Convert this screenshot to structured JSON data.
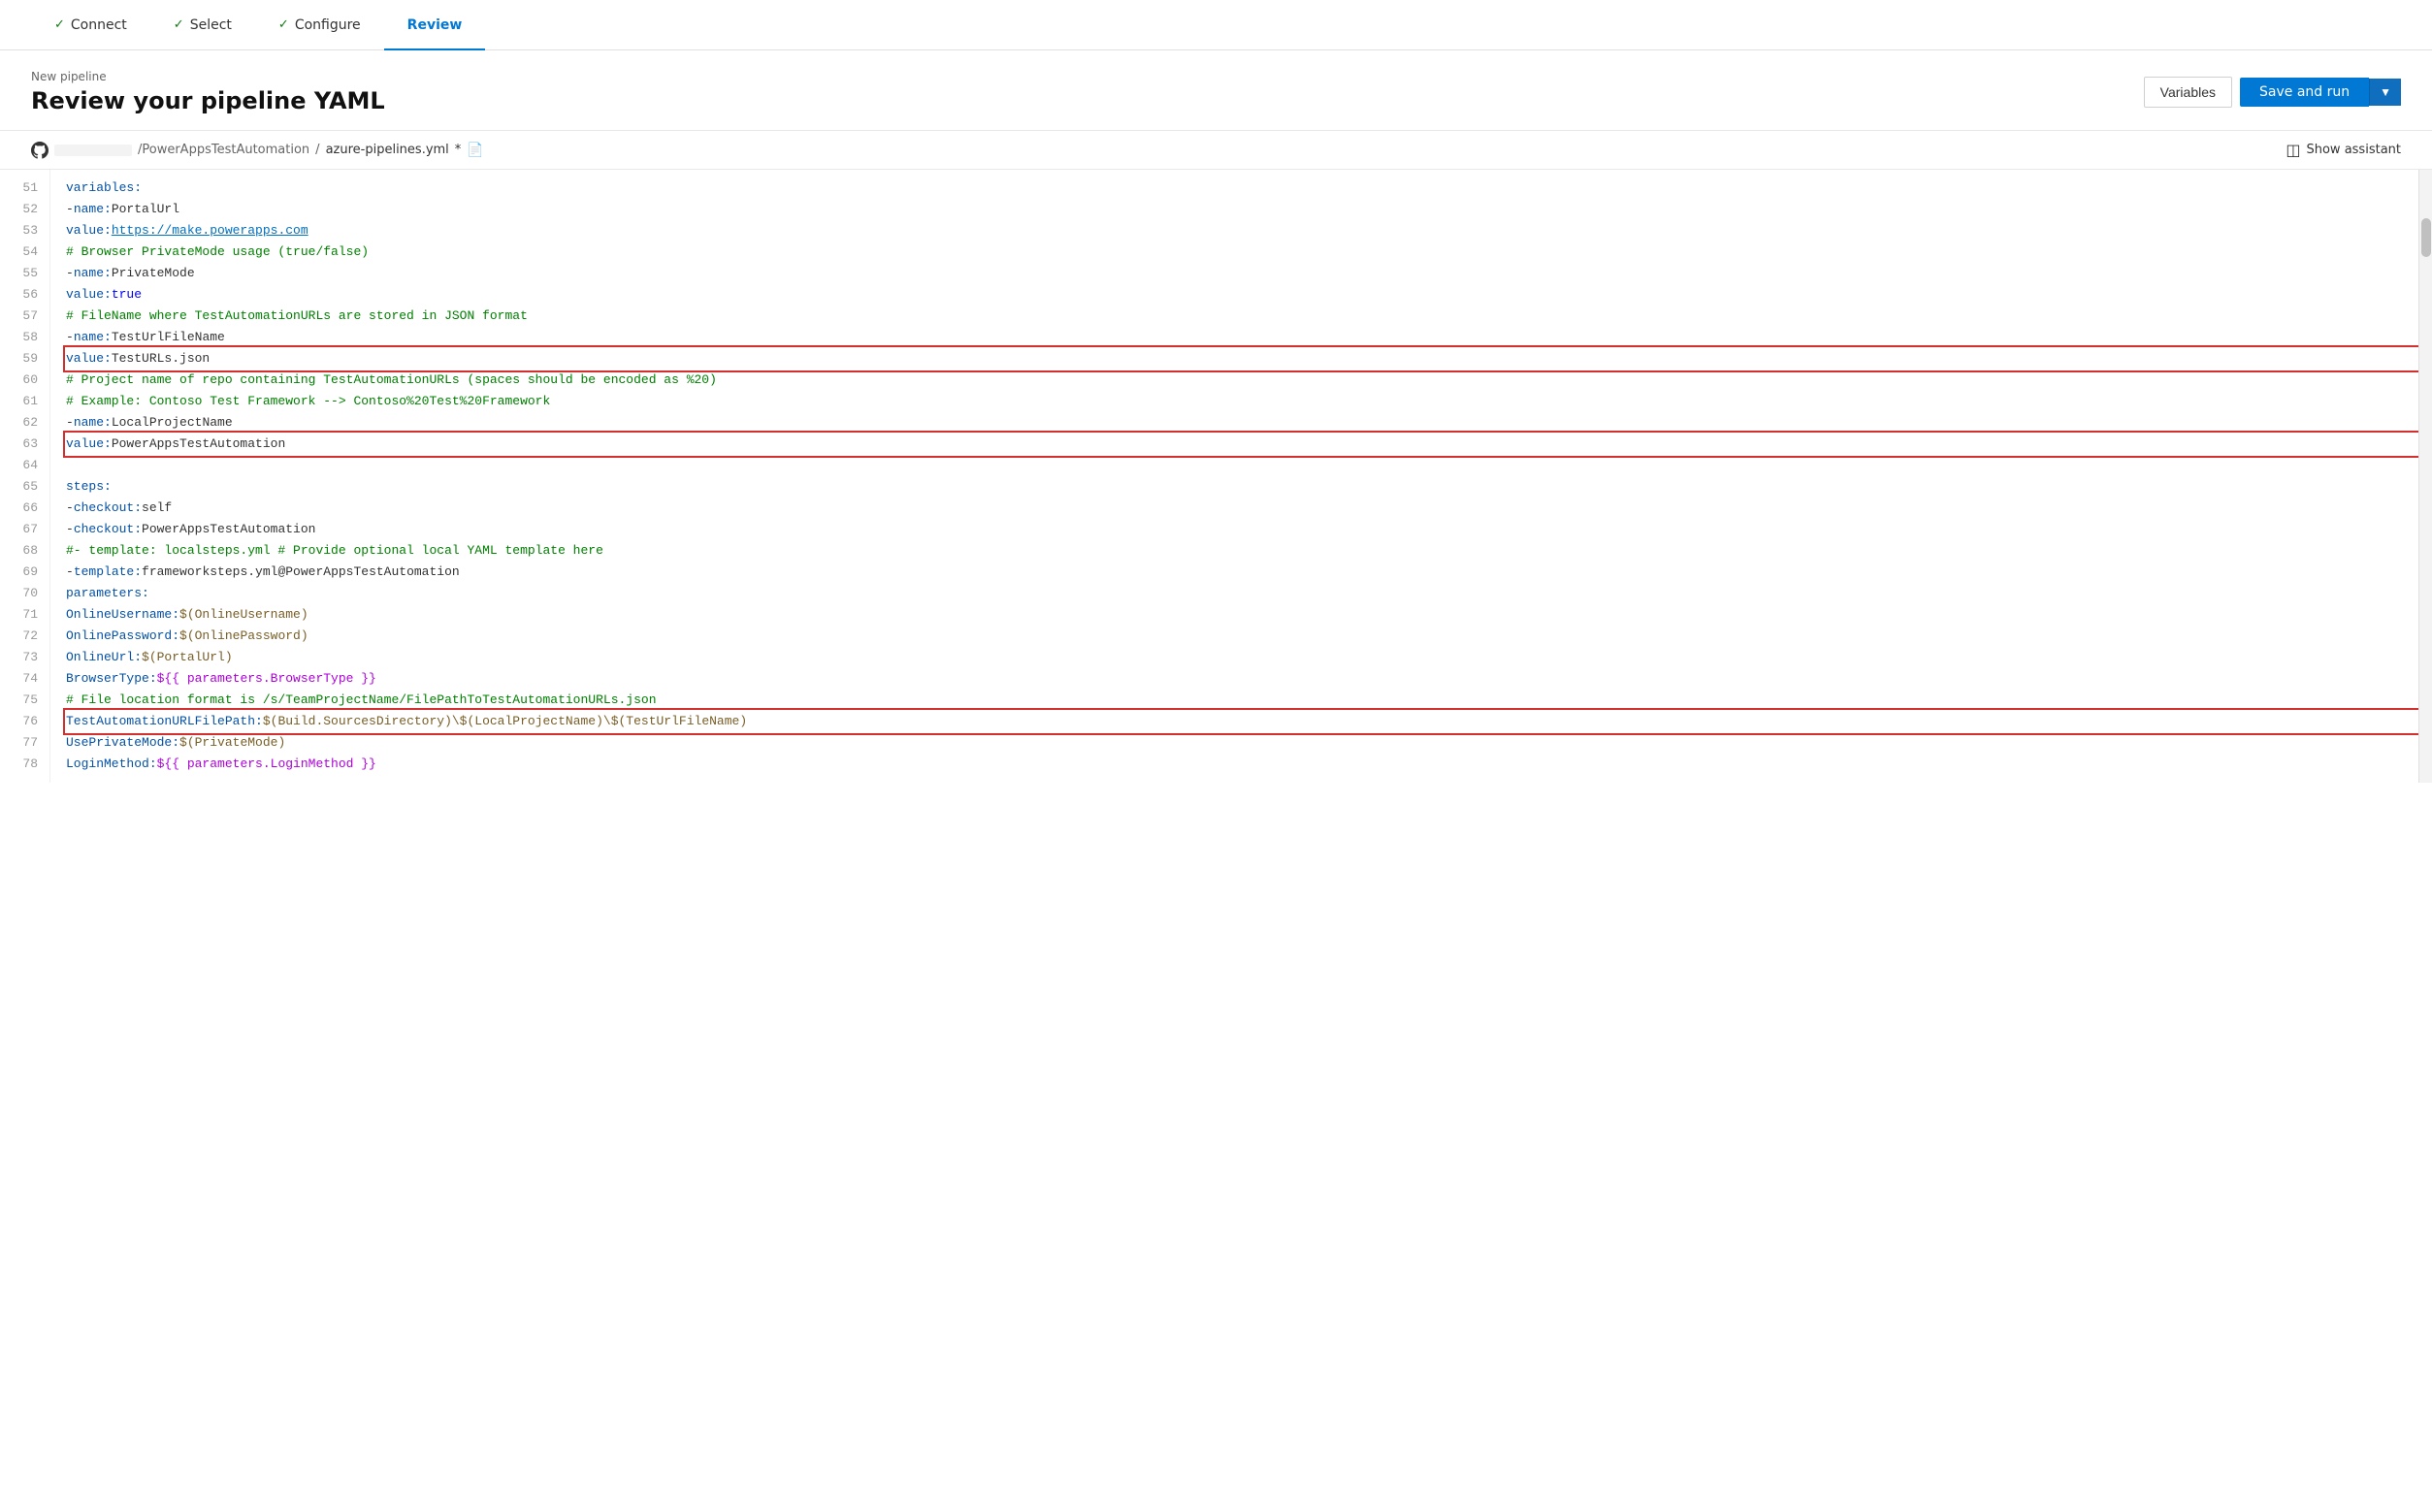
{
  "wizard": {
    "steps": [
      {
        "id": "connect",
        "label": "Connect",
        "completed": true,
        "active": false
      },
      {
        "id": "select",
        "label": "Select",
        "completed": true,
        "active": false
      },
      {
        "id": "configure",
        "label": "Configure",
        "completed": true,
        "active": false
      },
      {
        "id": "review",
        "label": "Review",
        "completed": false,
        "active": true
      }
    ]
  },
  "header": {
    "breadcrumb": "New pipeline",
    "title": "Review your pipeline YAML",
    "variables_btn": "Variables",
    "save_run_btn": "Save and run"
  },
  "file_bar": {
    "repo_placeholder": "repo",
    "repo_name": "/PowerAppsTestAutomation",
    "sep1": "/",
    "file_name": "azure-pipelines.yml",
    "modified": "*",
    "show_assistant": "Show assistant"
  },
  "code": {
    "lines": [
      {
        "num": 51,
        "content": "variables:",
        "parts": [
          {
            "t": "key",
            "v": "variables:"
          }
        ]
      },
      {
        "num": 52,
        "content": "  - name: PortalUrl",
        "parts": [
          {
            "t": "dash",
            "v": "  - "
          },
          {
            "t": "key",
            "v": "name:"
          },
          {
            "t": "text",
            "v": " PortalUrl"
          }
        ]
      },
      {
        "num": 53,
        "content": "    value: https://make.powerapps.com",
        "parts": [
          {
            "t": "indent",
            "v": "    "
          },
          {
            "t": "key",
            "v": "value:"
          },
          {
            "t": "text",
            "v": " "
          },
          {
            "t": "url",
            "v": "https://make.powerapps.com"
          }
        ]
      },
      {
        "num": 54,
        "content": "    # Browser PrivateMode usage (true/false)",
        "parts": [
          {
            "t": "indent",
            "v": "    "
          },
          {
            "t": "comment",
            "v": "# Browser PrivateMode usage (true/false)"
          }
        ]
      },
      {
        "num": 55,
        "content": "  - name: PrivateMode",
        "parts": [
          {
            "t": "dash",
            "v": "  - "
          },
          {
            "t": "key",
            "v": "name:"
          },
          {
            "t": "text",
            "v": " PrivateMode"
          }
        ]
      },
      {
        "num": 56,
        "content": "    value: true",
        "parts": [
          {
            "t": "indent",
            "v": "    "
          },
          {
            "t": "key",
            "v": "value:"
          },
          {
            "t": "text",
            "v": " "
          },
          {
            "t": "bool",
            "v": "true"
          }
        ]
      },
      {
        "num": 57,
        "content": "    # FileName where TestAutomationURLs are stored in JSON format",
        "parts": [
          {
            "t": "indent",
            "v": "    "
          },
          {
            "t": "comment",
            "v": "# FileName where TestAutomationURLs are stored in JSON format"
          }
        ]
      },
      {
        "num": 58,
        "content": "  - name: TestUrlFileName",
        "parts": [
          {
            "t": "dash",
            "v": "  - "
          },
          {
            "t": "key",
            "v": "name:"
          },
          {
            "t": "text",
            "v": " TestUrlFileName"
          }
        ]
      },
      {
        "num": 59,
        "content": "    value: TestURLs.json",
        "parts": [
          {
            "t": "indent",
            "v": "    "
          },
          {
            "t": "key",
            "v": "value:"
          },
          {
            "t": "text",
            "v": " TestURLs.json"
          }
        ],
        "redbox": true
      },
      {
        "num": 60,
        "content": "    # Project name of repo containing TestAutomationURLs (spaces should be encoded as %20)",
        "parts": [
          {
            "t": "indent",
            "v": "    "
          },
          {
            "t": "comment",
            "v": "# Project name of repo containing TestAutomationURLs (spaces should be encoded as %20)"
          }
        ]
      },
      {
        "num": 61,
        "content": "    # Example: Contoso Test Framework --> Contoso%20Test%20Framework",
        "parts": [
          {
            "t": "indent",
            "v": "    "
          },
          {
            "t": "comment",
            "v": "# Example: Contoso Test Framework --> Contoso%20Test%20Framework"
          }
        ]
      },
      {
        "num": 62,
        "content": "  - name: LocalProjectName",
        "parts": [
          {
            "t": "dash",
            "v": "  - "
          },
          {
            "t": "key",
            "v": "name:"
          },
          {
            "t": "text",
            "v": " LocalProjectName"
          }
        ]
      },
      {
        "num": 63,
        "content": "    value: PowerAppsTestAutomation",
        "parts": [
          {
            "t": "indent",
            "v": "    "
          },
          {
            "t": "key",
            "v": "value:"
          },
          {
            "t": "text",
            "v": " PowerAppsTestAutomation"
          }
        ],
        "redbox": true
      },
      {
        "num": 64,
        "content": "",
        "parts": []
      },
      {
        "num": 65,
        "content": "  steps:",
        "parts": [
          {
            "t": "indent",
            "v": "  "
          },
          {
            "t": "key",
            "v": "steps:"
          }
        ]
      },
      {
        "num": 66,
        "content": "  - checkout: self",
        "parts": [
          {
            "t": "indent",
            "v": "  "
          },
          {
            "t": "dash",
            "v": "- "
          },
          {
            "t": "key",
            "v": "checkout:"
          },
          {
            "t": "text",
            "v": " self"
          }
        ]
      },
      {
        "num": 67,
        "content": "  - checkout: PowerAppsTestAutomation",
        "parts": [
          {
            "t": "indent",
            "v": "  "
          },
          {
            "t": "dash",
            "v": "- "
          },
          {
            "t": "key",
            "v": "checkout:"
          },
          {
            "t": "text",
            "v": " PowerAppsTestAutomation"
          }
        ]
      },
      {
        "num": 68,
        "content": "  #- template: localsteps.yml # Provide optional local YAML template here",
        "parts": [
          {
            "t": "indent",
            "v": "  "
          },
          {
            "t": "comment",
            "v": "#- template: localsteps.yml # Provide optional local YAML template here"
          }
        ]
      },
      {
        "num": 69,
        "content": "  - template: frameworksteps.yml@PowerAppsTestAutomation",
        "parts": [
          {
            "t": "indent",
            "v": "  "
          },
          {
            "t": "dash",
            "v": "- "
          },
          {
            "t": "key",
            "v": "template:"
          },
          {
            "t": "text",
            "v": " frameworksteps.yml@PowerAppsTestAutomation"
          }
        ]
      },
      {
        "num": 70,
        "content": "    parameters:",
        "parts": [
          {
            "t": "indent",
            "v": "    "
          },
          {
            "t": "key",
            "v": "parameters:"
          }
        ]
      },
      {
        "num": 71,
        "content": "      OnlineUsername: $(OnlineUsername)",
        "parts": [
          {
            "t": "indent",
            "v": "      "
          },
          {
            "t": "key",
            "v": "OnlineUsername:"
          },
          {
            "t": "text",
            "v": " "
          },
          {
            "t": "var",
            "v": "$(OnlineUsername)"
          }
        ]
      },
      {
        "num": 72,
        "content": "      OnlinePassword: $(OnlinePassword)",
        "parts": [
          {
            "t": "indent",
            "v": "      "
          },
          {
            "t": "key",
            "v": "OnlinePassword:"
          },
          {
            "t": "text",
            "v": " "
          },
          {
            "t": "var",
            "v": "$(OnlinePassword)"
          }
        ]
      },
      {
        "num": 73,
        "content": "      OnlineUrl: $(PortalUrl)",
        "parts": [
          {
            "t": "indent",
            "v": "      "
          },
          {
            "t": "key",
            "v": "OnlineUrl:"
          },
          {
            "t": "text",
            "v": " "
          },
          {
            "t": "var",
            "v": "$(PortalUrl)"
          }
        ]
      },
      {
        "num": 74,
        "content": "      BrowserType: ${{ parameters.BrowserType }}",
        "parts": [
          {
            "t": "indent",
            "v": "      "
          },
          {
            "t": "key",
            "v": "BrowserType:"
          },
          {
            "t": "text",
            "v": " "
          },
          {
            "t": "tpl",
            "v": "${{ parameters.BrowserType }}"
          }
        ]
      },
      {
        "num": 75,
        "content": "      # File location format is /s/TeamProjectName/FilePathToTestAutomationURLs.json",
        "parts": [
          {
            "t": "indent",
            "v": "      "
          },
          {
            "t": "comment",
            "v": "# File location format is /s/TeamProjectName/FilePathToTestAutomationURLs.json"
          }
        ]
      },
      {
        "num": 76,
        "content": "      TestAutomationURLFilePath: $(Build.SourcesDirectory)\\$(LocalProjectName)\\$(TestUrlFileName)",
        "parts": [
          {
            "t": "indent",
            "v": "      "
          },
          {
            "t": "key",
            "v": "TestAutomationURLFilePath:"
          },
          {
            "t": "text",
            "v": " "
          },
          {
            "t": "var",
            "v": "$(Build.SourcesDirectory)\\$(LocalProjectName)\\$(TestUrlFileName)"
          }
        ],
        "redbox": true
      },
      {
        "num": 77,
        "content": "      UsePrivateMode: $(PrivateMode)",
        "parts": [
          {
            "t": "indent",
            "v": "      "
          },
          {
            "t": "key",
            "v": "UsePrivateMode:"
          },
          {
            "t": "text",
            "v": " "
          },
          {
            "t": "var",
            "v": "$(PrivateMode)"
          }
        ]
      },
      {
        "num": 78,
        "content": "      LoginMethod: ${{ parameters.LoginMethod }}",
        "parts": [
          {
            "t": "indent",
            "v": "      "
          },
          {
            "t": "key",
            "v": "LoginMethod:"
          },
          {
            "t": "text",
            "v": " "
          },
          {
            "t": "tpl",
            "v": "${{ parameters.LoginMethod }}"
          }
        ]
      }
    ]
  },
  "icons": {
    "github": "github-icon",
    "show_assistant": "show-assistant-icon",
    "chevron_down": "chevron-down-icon",
    "file_edit": "file-edit-icon"
  }
}
